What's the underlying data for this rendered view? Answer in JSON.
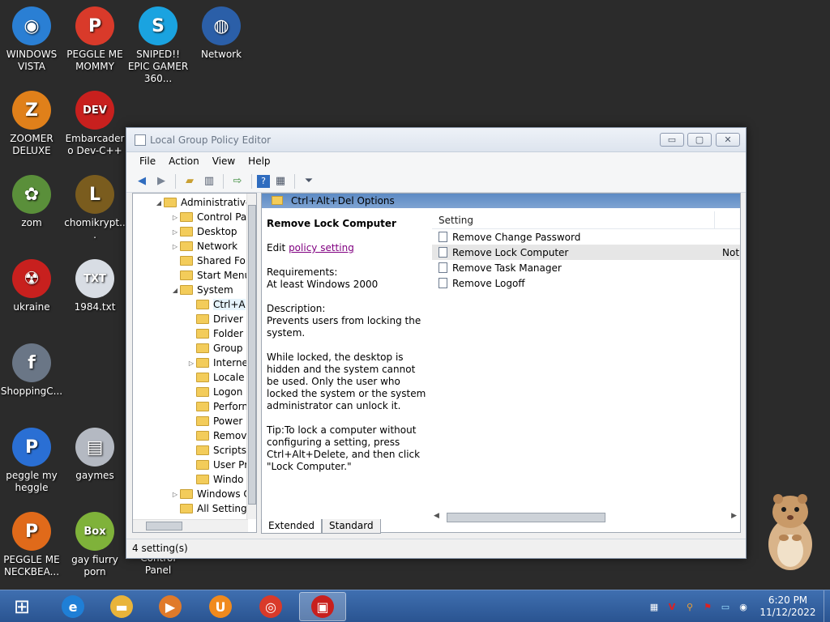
{
  "desktop": {
    "icons": [
      {
        "label": "WINDOWS VISTA",
        "color": "#2a7fd4",
        "glyph": "◉"
      },
      {
        "label": "PEGGLE ME MOMMY",
        "color": "#d93a2a",
        "glyph": "P"
      },
      {
        "label": "SNIPED!! EPIC GAMER 360...",
        "color": "#1aa3e0",
        "glyph": "S"
      },
      {
        "label": "Network",
        "color": "#2b5fa8",
        "glyph": "◍"
      },
      {
        "label": "ZOOMER DELUXE",
        "color": "#e0801a",
        "glyph": "Z"
      },
      {
        "label": "Embarcadero Dev-C++",
        "color": "#c8201e",
        "glyph": "DEV"
      },
      {
        "label": "zom",
        "color": "#5a8f3a",
        "glyph": "✿"
      },
      {
        "label": "chomikrypt...",
        "color": "#7a5c1e",
        "glyph": "L"
      },
      {
        "label": "ukraine",
        "color": "#c8201e",
        "glyph": "☢"
      },
      {
        "label": "1984.txt",
        "color": "#d8dde4",
        "glyph": "TXT"
      },
      {
        "label": "ShoppingC...",
        "color": "#6a7686",
        "glyph": "f"
      },
      {
        "label": "peggle my heggle",
        "color": "#2a6fd4",
        "glyph": "P"
      },
      {
        "label": "gaymes",
        "color": "#b4b9c2",
        "glyph": "▤"
      },
      {
        "label": "PEGGLE ME NECKBEA...",
        "color": "#e06a1a",
        "glyph": "P"
      },
      {
        "label": "gay fiurry porn",
        "color": "#7fb23a",
        "glyph": "Box"
      }
    ],
    "overlap_label": "Control Panel"
  },
  "window": {
    "title": "Local Group Policy Editor",
    "buttons": {
      "minimize": "▭",
      "maximize": "▢",
      "close": "✕"
    },
    "menu": [
      "File",
      "Action",
      "View",
      "Help"
    ],
    "tree": [
      {
        "label": "Administrative",
        "arrow": "◢",
        "indent": 0
      },
      {
        "label": "Control Pa",
        "arrow": "▷",
        "indent": 1
      },
      {
        "label": "Desktop",
        "arrow": "▷",
        "indent": 1
      },
      {
        "label": "Network",
        "arrow": "▷",
        "indent": 1
      },
      {
        "label": "Shared Fol",
        "arrow": "",
        "indent": 1
      },
      {
        "label": "Start Menu",
        "arrow": "",
        "indent": 1
      },
      {
        "label": "System",
        "arrow": "◢",
        "indent": 1
      },
      {
        "label": "Ctrl+A",
        "arrow": "",
        "indent": 2,
        "selected": true
      },
      {
        "label": "Driver I",
        "arrow": "",
        "indent": 2
      },
      {
        "label": "Folder",
        "arrow": "",
        "indent": 2
      },
      {
        "label": "Group",
        "arrow": "",
        "indent": 2
      },
      {
        "label": "Interne",
        "arrow": "▷",
        "indent": 2
      },
      {
        "label": "Locale",
        "arrow": "",
        "indent": 2
      },
      {
        "label": "Logon",
        "arrow": "",
        "indent": 2
      },
      {
        "label": "Perforn",
        "arrow": "",
        "indent": 2
      },
      {
        "label": "Power",
        "arrow": "",
        "indent": 2
      },
      {
        "label": "Remov",
        "arrow": "",
        "indent": 2
      },
      {
        "label": "Scripts",
        "arrow": "",
        "indent": 2
      },
      {
        "label": "User Pr",
        "arrow": "",
        "indent": 2
      },
      {
        "label": "Windo",
        "arrow": "",
        "indent": 2
      },
      {
        "label": "Windows C",
        "arrow": "▷",
        "indent": 1
      },
      {
        "label": "All Setting",
        "arrow": "",
        "indent": 1
      }
    ],
    "pane_title": "Ctrl+Alt+Del Options",
    "description": {
      "heading": "Remove Lock Computer",
      "edit_prefix": "Edit ",
      "edit_link": "policy setting ",
      "requirements_label": "Requirements:",
      "requirements_value": "At least Windows 2000",
      "description_label": "Description:",
      "description_value": "Prevents users from locking the system.",
      "details": "While locked, the desktop is hidden and the system cannot be used. Only the user who locked the system or the system administrator can unlock it.",
      "tip": "Tip:To lock a computer without configuring a setting, press Ctrl+Alt+Delete, and then click \"Lock Computer.\""
    },
    "list": {
      "column_setting": "Setting",
      "rows": [
        {
          "label": "Remove Change Password",
          "state": ""
        },
        {
          "label": "Remove Lock Computer",
          "state": "Not",
          "selected": true
        },
        {
          "label": "Remove Task Manager",
          "state": ""
        },
        {
          "label": "Remove Logoff",
          "state": ""
        }
      ]
    },
    "tabs": [
      "Extended",
      "Standard"
    ],
    "status": "4 setting(s)"
  },
  "taskbar": {
    "start_glyph": "⊞",
    "apps": [
      {
        "name": "internet-explorer",
        "glyph": "e",
        "color": "#1f7fd6"
      },
      {
        "name": "file-explorer",
        "glyph": "▬",
        "color": "#e9b43a"
      },
      {
        "name": "media-player",
        "glyph": "▶",
        "color": "#e07a2a"
      },
      {
        "name": "uc-browser",
        "glyph": "U",
        "color": "#f08a1e"
      },
      {
        "name": "chrome",
        "glyph": "◎",
        "color": "#d93a2a"
      },
      {
        "name": "group-policy-editor",
        "glyph": "▣",
        "color": "#c8201e"
      }
    ],
    "clock_time": "6:20 PM",
    "clock_date": "11/12/2022"
  }
}
